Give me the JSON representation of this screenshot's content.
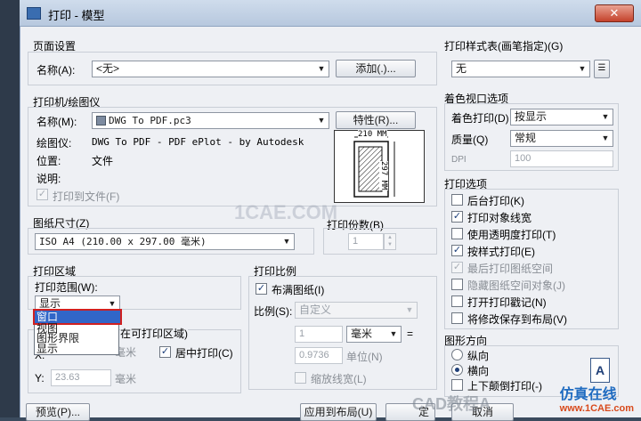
{
  "window": {
    "title": "打印 - 模型",
    "close_label": "✕"
  },
  "page_setup": {
    "title": "页面设置",
    "name_label": "名称(A):",
    "name_value": "<无>",
    "add_button": "添加(.)..."
  },
  "printer": {
    "title": "打印机/绘图仪",
    "name_label": "名称(M):",
    "name_value": "DWG To PDF.pc3",
    "props_button": "特性(R)...",
    "plotter_label": "绘图仪:",
    "plotter_value": "DWG To PDF - PDF ePlot - by Autodesk",
    "location_label": "位置:",
    "location_value": "文件",
    "desc_label": "说明:",
    "print_to_file": "打印到文件(F)",
    "preview_width": "210 MM",
    "preview_height": "297 MM"
  },
  "paper_size": {
    "title": "图纸尺寸(Z)",
    "value": "ISO A4 (210.00 x 297.00 毫米)"
  },
  "copies": {
    "title": "打印份数(B)",
    "value": "1"
  },
  "plot_area": {
    "title": "打印区域",
    "range_label": "打印范围(W):",
    "range_value": "显示",
    "options": [
      "窗口",
      "视图",
      "图形界限",
      "显示"
    ]
  },
  "offset": {
    "title": "在可打印区域)",
    "x_label": "X:",
    "x_unit": "毫米",
    "center_label": "居中打印(C)",
    "y_label": "Y:",
    "y_value": "23.63",
    "y_unit": "毫米"
  },
  "scale": {
    "title": "打印比例",
    "fit_label": "布满图纸(I)",
    "ratio_label": "比例(S):",
    "ratio_value": "自定义",
    "value1": "1",
    "unit_value": "毫米",
    "equals": "=",
    "value2": "0.9736",
    "unit_label": "单位(N)",
    "lineweights": "缩放线宽(L)"
  },
  "plot_style": {
    "title": "打印样式表(画笔指定)(G)",
    "value": "无"
  },
  "shaded": {
    "title": "着色视口选项",
    "shade_label": "着色打印(D)",
    "shade_value": "按显示",
    "quality_label": "质量(Q)",
    "quality_value": "常规",
    "dpi_label": "DPI",
    "dpi_value": "100"
  },
  "options": {
    "title": "打印选项",
    "items": [
      {
        "label": "后台打印(K)",
        "checked": ""
      },
      {
        "label": "打印对象线宽",
        "checked": "✓"
      },
      {
        "label": "使用透明度打印(T)",
        "checked": ""
      },
      {
        "label": "按样式打印(E)",
        "checked": "✓"
      },
      {
        "label": "最后打印图纸空间",
        "checked": "✓"
      },
      {
        "label": "隐藏图纸空间对象(J)",
        "checked": ""
      },
      {
        "label": "打开打印戳记(N)",
        "checked": ""
      },
      {
        "label": "将修改保存到布局(V)",
        "checked": ""
      }
    ]
  },
  "orientation": {
    "title": "图形方向",
    "portrait": "纵向",
    "landscape": "横向",
    "upside_down": "上下颠倒打印(-)"
  },
  "footer": {
    "preview_button": "预览(P)...",
    "apply_button": "应用到布局(U)",
    "ok_button": "定",
    "cancel_button": "取消"
  },
  "watermarks": {
    "center": "1CAE.COM",
    "wechat": "CAD教程A",
    "brand_cn": "仿真在线",
    "brand_en": "www.1CAE.com"
  },
  "colors": {
    "accent": "#3166c8",
    "highlight": "#d02020"
  }
}
